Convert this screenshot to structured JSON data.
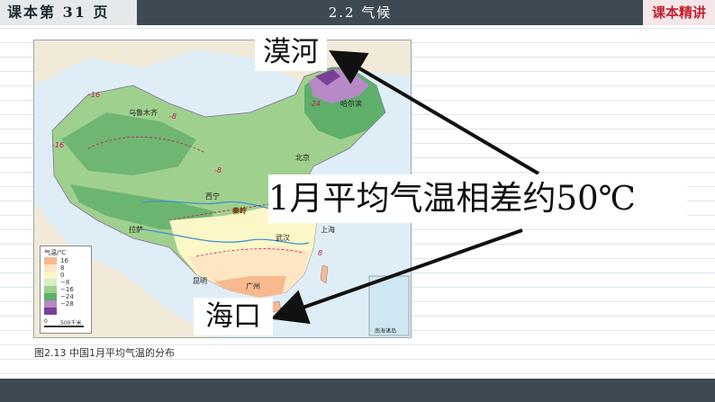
{
  "header": {
    "page_ref": "课本第  31  页",
    "title": "2.2  气候",
    "tag": "课本精讲"
  },
  "map": {
    "legend_title": "气温/℃",
    "legend": [
      {
        "label": "16",
        "color": "#f7b98d"
      },
      {
        "label": "8",
        "color": "#fde6c4"
      },
      {
        "label": "0",
        "color": "#fbf7c6"
      },
      {
        "label": "−8",
        "color": "#d7ecc4"
      },
      {
        "label": "−16",
        "color": "#9fd08e"
      },
      {
        "label": "−24",
        "color": "#5fae6a"
      },
      {
        "label": "−28",
        "color": "#b789c6"
      },
      {
        "label": "",
        "color": "#7a3f98"
      }
    ],
    "scale_start": "0",
    "scale_label": "500千米",
    "cities": [
      "乌鲁木齐",
      "哈尔滨",
      "北京",
      "西宁",
      "武汉",
      "上海",
      "昆明",
      "广州",
      "拉萨"
    ],
    "isotherms": [
      "-16",
      "-8",
      "-24",
      "-16",
      "-8",
      "0",
      "8"
    ],
    "mountain_label": "秦岭",
    "inset_label": "南海诸岛"
  },
  "caption": "图2.13  中国1月平均气温的分布",
  "annotations": {
    "mohe": "漠河",
    "difference": "1月平均气温相差约50℃",
    "haikou": "海口"
  }
}
